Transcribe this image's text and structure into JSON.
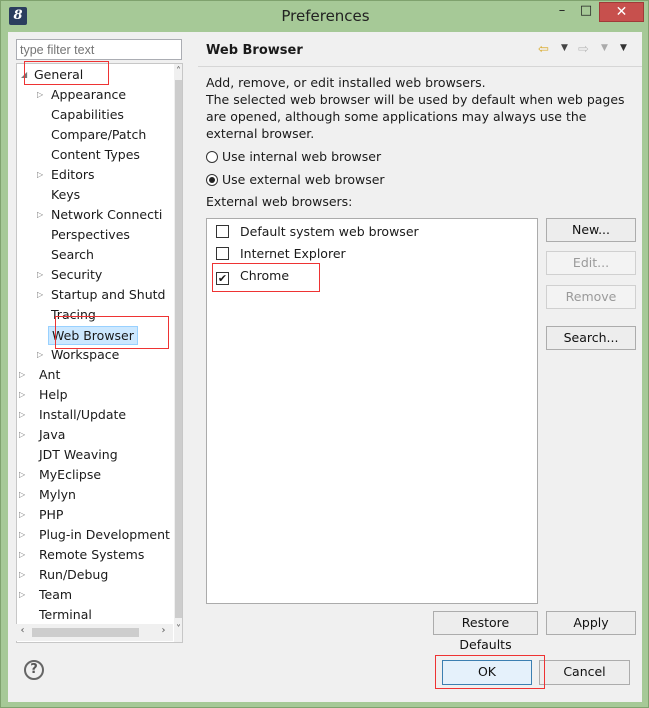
{
  "window": {
    "title": "Preferences",
    "app_icon": "8",
    "minimize_glyph": "–",
    "maximize_glyph": "□",
    "close_glyph": "✕"
  },
  "filter": {
    "placeholder": "type filter text"
  },
  "tree": {
    "general": "General",
    "general_children": [
      "Appearance",
      "Capabilities",
      "Compare/Patch",
      "Content Types",
      "Editors",
      "Keys",
      "Network Connecti",
      "Perspectives",
      "Search",
      "Security",
      "Startup and Shutd",
      "Tracing",
      "Web Browser",
      "Workspace"
    ],
    "top_level": [
      "Ant",
      "Help",
      "Install/Update",
      "Java",
      "JDT Weaving",
      "MyEclipse",
      "Mylyn",
      "PHP",
      "Plug-in Development",
      "Remote Systems",
      "Run/Debug",
      "Team",
      "Terminal"
    ]
  },
  "page": {
    "title": "Web Browser",
    "description": "Add, remove, or edit installed web browsers.\nThe selected web browser will be used by default when web pages are opened, although some applications may always use the external browser.",
    "radio_internal": "Use internal web browser",
    "radio_external": "Use external web browser",
    "selected_radio": "external",
    "external_label": "External web browsers:",
    "browsers": [
      {
        "name": "Default system web browser",
        "checked": false
      },
      {
        "name": "Internet Explorer",
        "checked": false
      },
      {
        "name": "Chrome",
        "checked": true
      }
    ]
  },
  "buttons": {
    "new": "New...",
    "edit": "Edit...",
    "remove": "Remove",
    "search": "Search...",
    "restore_defaults": "Restore Defaults",
    "apply": "Apply",
    "ok": "OK",
    "cancel": "Cancel",
    "help": "?"
  },
  "colors": {
    "window_frame": "#a6c997",
    "selection": "#cce8ff",
    "highlight_box": "#ee3333"
  }
}
